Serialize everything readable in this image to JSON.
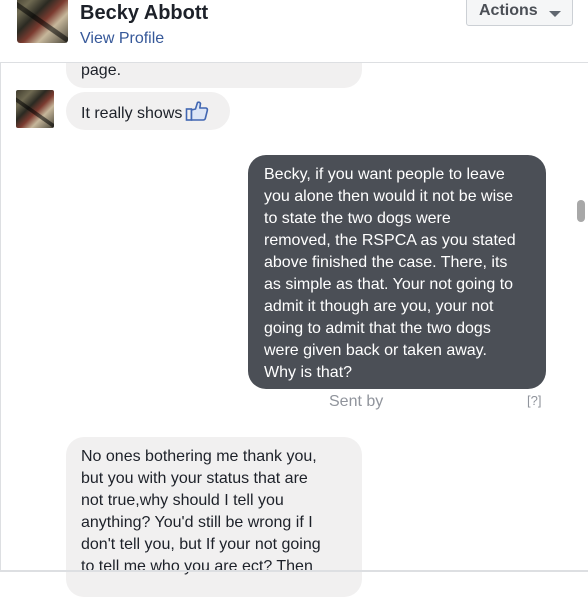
{
  "header": {
    "name": "Becky Abbott",
    "profile_link": "View Profile",
    "actions_label": "Actions"
  },
  "messages": [
    {
      "side": "in",
      "text": "page."
    },
    {
      "side": "in",
      "text": "It really shows",
      "icon": "thumbs-up-icon"
    },
    {
      "side": "out",
      "lines": [
        "Becky, if you want people to leave",
        "you alone then would it not be wise",
        "to state the two dogs were",
        "removed, the RSPCA as you stated",
        "above finished the case. There, its",
        "as simple as that. Your not going to",
        "admit it though are you, your not",
        "going to admit that the two dogs",
        "were given back or taken away.",
        "Why is that?"
      ]
    },
    {
      "side": "in",
      "lines": [
        "No ones bothering me thank you,",
        "but you with your status that are",
        "not true,why should I tell you",
        "anything? You'd still be wrong if I",
        "don't tell you, but If your not going",
        "to tell me who you are ect? Then"
      ]
    }
  ],
  "sent_by_label": "Sent by",
  "help_label": "[?]",
  "colors": {
    "link": "#365899",
    "incoming_bubble": "#f1f0f0",
    "outgoing_bubble": "#4b4f56",
    "like_icon": "#4267b2"
  }
}
